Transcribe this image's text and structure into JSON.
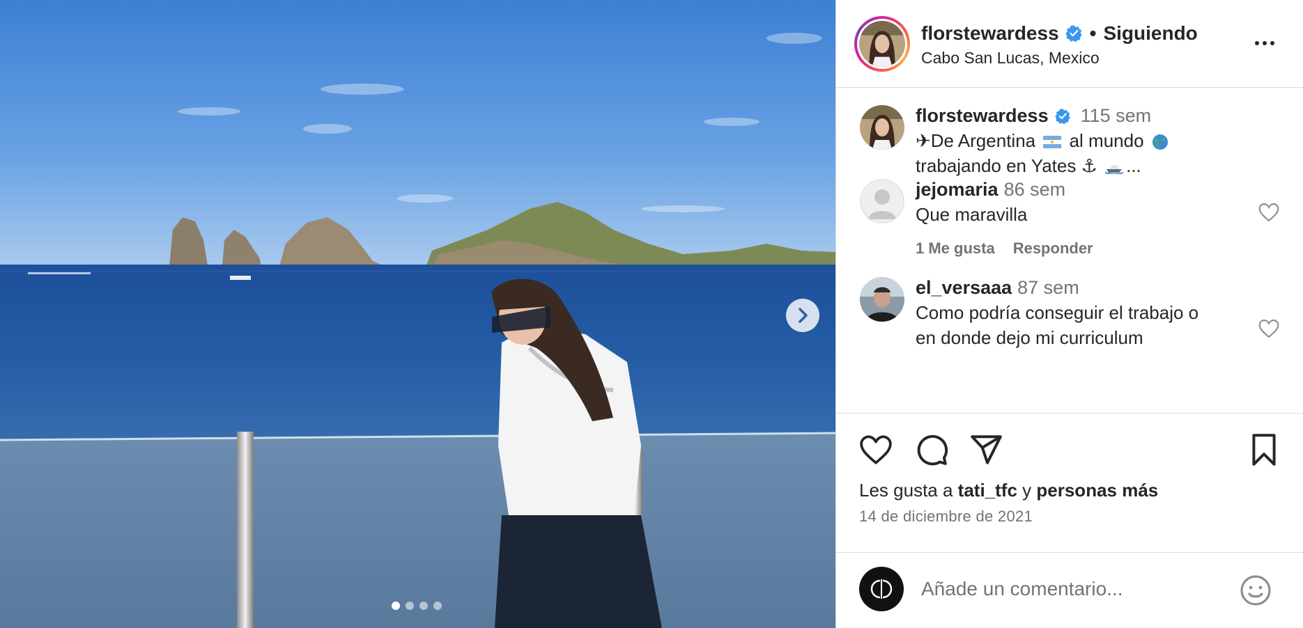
{
  "post": {
    "username": "florstewardess",
    "verified": true,
    "separator": "•",
    "follow_state": "Siguiendo",
    "location": "Cabo San Lucas, Mexico",
    "carousel": {
      "total_slides": 4,
      "current_slide": 1
    }
  },
  "caption": {
    "username": "florstewardess",
    "time": "115 sem",
    "line1_a": "✈De Argentina",
    "line1_b": "al mundo",
    "line2": "trabajando en Yates ⚓",
    "line2_tail": "..."
  },
  "comments": [
    {
      "username": "jejomaria",
      "time": "86 sem",
      "text": "Que maravilla",
      "likes_label": "1 Me gusta",
      "reply_label": "Responder"
    },
    {
      "username": "el_versaaa",
      "time": "87 sem",
      "text_line1": "Como podría conseguir el trabajo o",
      "text_line2": "en donde dejo mi curriculum"
    }
  ],
  "likes": {
    "prefix": "Les gusta a",
    "user": "tati_tfc",
    "joiner": "y",
    "others": "personas más"
  },
  "date": "14 de diciembre de 2021",
  "composer": {
    "placeholder": "Añade un comentario..."
  },
  "icons": [
    "verified-badge-icon",
    "more-options-icon",
    "heart-icon",
    "comment-icon",
    "share-icon",
    "bookmark-icon",
    "emoji-icon",
    "chevron-right-icon",
    "argentina-flag-icon",
    "globe-icon",
    "boat-icon"
  ],
  "colors": {
    "verified": "#3897f0",
    "secondary_text": "#737373",
    "border": "#dbdbdb"
  }
}
